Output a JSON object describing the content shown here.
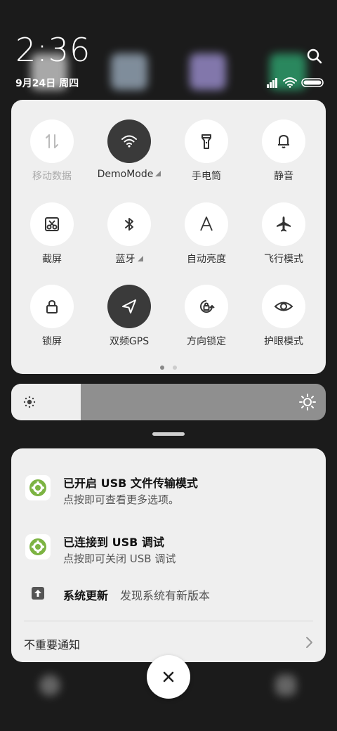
{
  "status_bar": {
    "time": "2:36",
    "date": "9月24日 周四"
  },
  "quick_settings": [
    {
      "id": "mobile-data",
      "label": "移动数据",
      "icon": "mobile-data-icon",
      "active": false,
      "dim": true,
      "expand": false
    },
    {
      "id": "wifi",
      "label": "DemoMode",
      "icon": "wifi-icon",
      "active": true,
      "dim": false,
      "expand": true
    },
    {
      "id": "flashlight",
      "label": "手电筒",
      "icon": "flashlight-icon",
      "active": false,
      "dim": false,
      "expand": false
    },
    {
      "id": "silent",
      "label": "静音",
      "icon": "bell-icon",
      "active": false,
      "dim": false,
      "expand": false
    },
    {
      "id": "screenshot",
      "label": "截屏",
      "icon": "screenshot-icon",
      "active": false,
      "dim": false,
      "expand": false
    },
    {
      "id": "bluetooth",
      "label": "蓝牙",
      "icon": "bluetooth-icon",
      "active": false,
      "dim": false,
      "expand": true
    },
    {
      "id": "auto-brightness",
      "label": "自动亮度",
      "icon": "auto-brightness-icon",
      "active": false,
      "dim": false,
      "expand": false
    },
    {
      "id": "airplane",
      "label": "飞行模式",
      "icon": "airplane-icon",
      "active": false,
      "dim": false,
      "expand": false
    },
    {
      "id": "lock-screen",
      "label": "锁屏",
      "icon": "lock-icon",
      "active": false,
      "dim": false,
      "expand": false
    },
    {
      "id": "gps",
      "label": "双频GPS",
      "icon": "location-arrow-icon",
      "active": true,
      "dim": false,
      "expand": false
    },
    {
      "id": "rotation-lock",
      "label": "方向锁定",
      "icon": "rotation-lock-icon",
      "active": false,
      "dim": false,
      "expand": false
    },
    {
      "id": "eye-care",
      "label": "护眼模式",
      "icon": "eye-icon",
      "active": false,
      "dim": false,
      "expand": false
    }
  ],
  "page_indicator": {
    "pages": 2,
    "current": 1
  },
  "brightness": {
    "level": 0.22
  },
  "notifications": [
    {
      "title": "已开启 USB 文件传输模式",
      "subtitle": "点按即可查看更多选项。",
      "icon": "settings-gear-icon"
    },
    {
      "title": "已连接到 USB 调试",
      "subtitle": "点按即可关闭 USB 调试",
      "icon": "settings-gear-icon"
    },
    {
      "title": "系统更新",
      "subtitle": "发现系统有新版本",
      "icon": "upload-arrow-icon"
    }
  ],
  "unimportant_label": "不重要通知",
  "colors": {
    "active_tile": "#3a3a3a",
    "accent_green": "#7cb342"
  }
}
